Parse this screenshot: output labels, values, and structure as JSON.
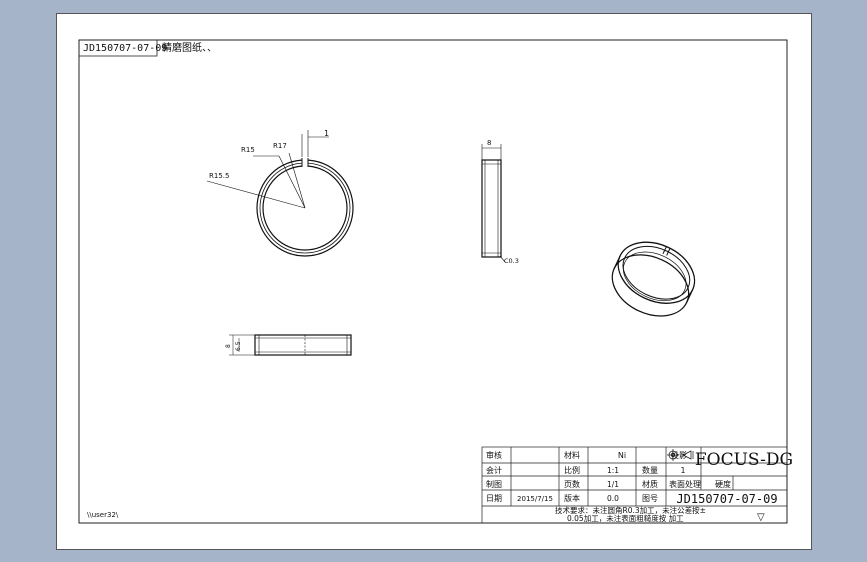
{
  "drawing": {
    "title_tag": "JD150707-07-09",
    "title_note": "精磨图纸、、",
    "path_text": "\\\\user32\\",
    "dimensions": {
      "r15": "R15",
      "r17": "R17",
      "r15_5": "R15.5",
      "gap": "1",
      "width": "8",
      "chamfer": "C0.3",
      "height_outer": "8",
      "height_inner": "6.5"
    }
  },
  "title_block": {
    "rows": [
      [
        "审核",
        "",
        "材料",
        "",
        "投影",
        ""
      ],
      [
        "会计",
        "",
        "比例",
        "1:1",
        "数量",
        "1"
      ],
      [
        "制图",
        "",
        "页数",
        "1/1",
        "材质",
        "表面处理"
      ],
      [
        "日期",
        "2015/7/15",
        "版本",
        "0.0",
        "图号",
        ""
      ]
    ],
    "material_value": "Ni",
    "hardness_label": "硬度",
    "company": "FOCUS-DG",
    "part_number": "JD150707-07-09",
    "notes_line1": "技术要求：未注圆角R0.3加工，未注公差按±",
    "notes_line2": "0.05加工，未注表面粗糙度按    加工",
    "roughness_symbol": "▽"
  }
}
